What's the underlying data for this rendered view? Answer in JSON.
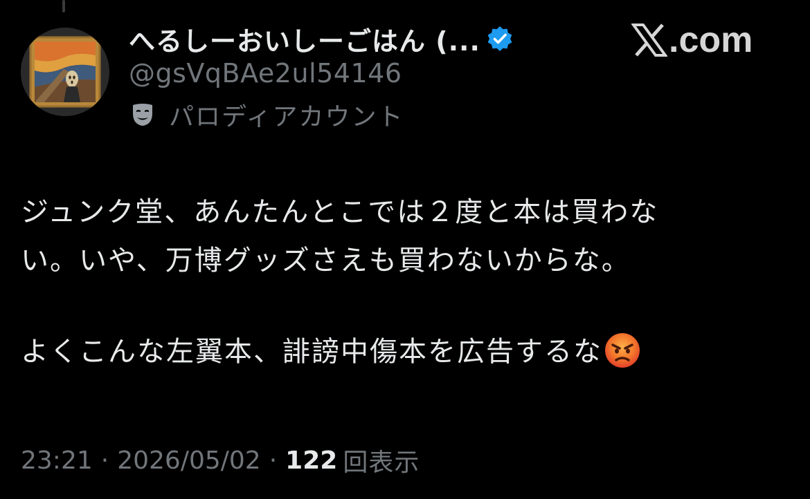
{
  "author": {
    "display_name": "へるしーおいしーごはん (...",
    "handle": "@gsVqBAe2ul54146",
    "account_label": "パロディアカウント",
    "avatar_icon": "the-scream-painting-avatar",
    "verified_icon": "verified-badge-icon",
    "account_label_icon": "theater-mask-icon"
  },
  "watermark": {
    "text": ".com",
    "icon": "x-logo-icon"
  },
  "tweet": {
    "lines": [
      "ジュンク堂、あんたんとこでは２度と本は買わな",
      "い。いや、万博グッズさえも買わないからな。",
      "よくこんな左翼本、誹謗中傷本を広告するな"
    ],
    "emoji": "angry-face-emoji"
  },
  "meta": {
    "time": "23:21",
    "separator": "·",
    "date": "2026/05/02",
    "views_count": "122",
    "views_label": "回表示"
  },
  "colors": {
    "background": "#000000",
    "primary_text": "#e7e9ea",
    "secondary_text": "#71767b",
    "verified_blue": "#1d9bf0",
    "emoji_red": "#f0592a"
  }
}
